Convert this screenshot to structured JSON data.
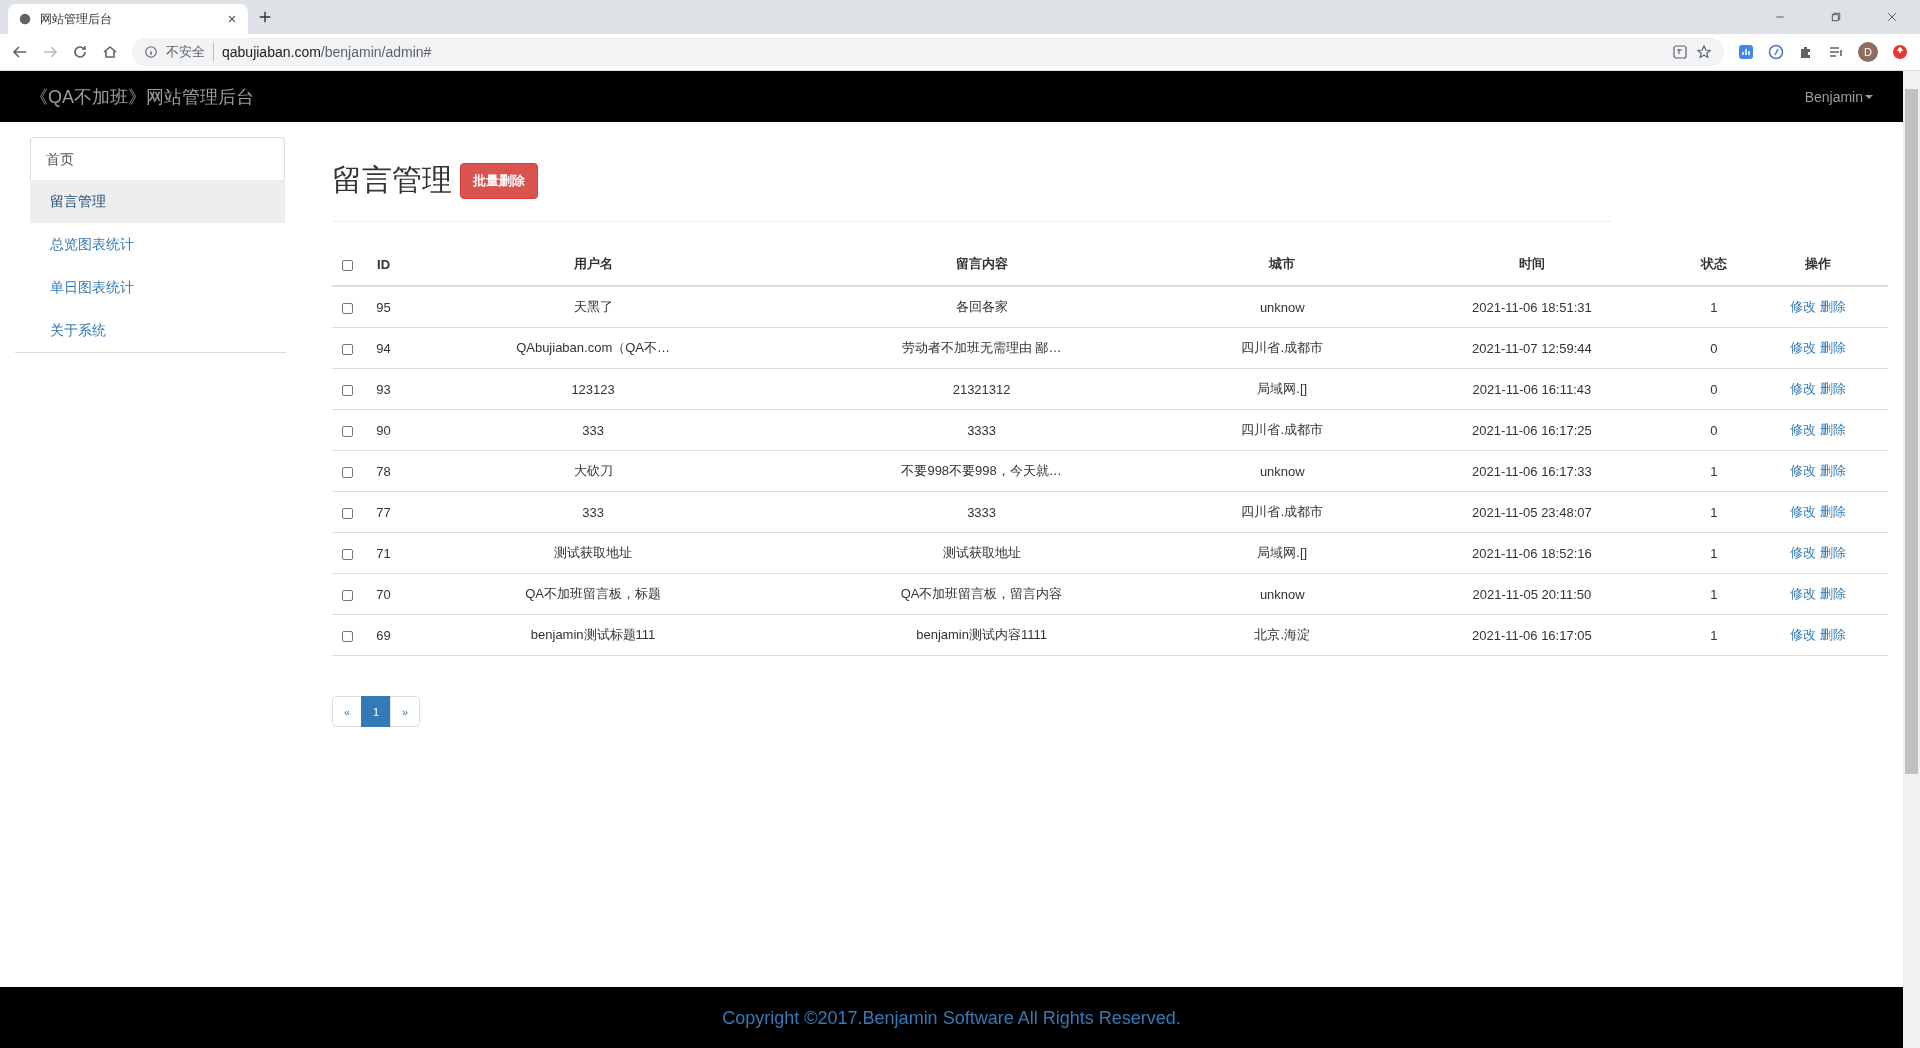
{
  "browser": {
    "tab_title": "网站管理后台",
    "security_label": "不安全",
    "url_host": "qabujiaban.com",
    "url_path": "/benjamin/admin#",
    "profile_initial": "D"
  },
  "navbar": {
    "brand": "《QA不加班》网站管理后台",
    "user": "Benjamin"
  },
  "sidebar": {
    "items": [
      {
        "label": "首页",
        "kind": "header",
        "selected": false
      },
      {
        "label": "留言管理",
        "kind": "link",
        "selected": true
      },
      {
        "label": "总览图表统计",
        "kind": "link",
        "selected": false
      },
      {
        "label": "单日图表统计",
        "kind": "link",
        "selected": false
      },
      {
        "label": "关于系统",
        "kind": "link",
        "selected": false
      }
    ]
  },
  "page": {
    "title": "留言管理",
    "bulk_delete": "批量删除"
  },
  "table": {
    "select_all_checked": false,
    "columns": [
      "ID",
      "用户名",
      "留言内容",
      "城市",
      "时间",
      "状态",
      "操作"
    ],
    "rows": [
      {
        "checked": false,
        "cells": [
          "95",
          "天黑了",
          "各回各家",
          "unknow",
          "2021-11-06 18:51:31",
          "1"
        ],
        "actions": [
          "修改",
          "删除"
        ]
      },
      {
        "checked": false,
        "cells": [
          "94",
          "QAbujiaban.com（QA不…",
          "劳动者不加班无需理由 鄙…",
          "四川省.成都市",
          "2021-11-07 12:59:44",
          "0"
        ],
        "actions": [
          "修改",
          "删除"
        ]
      },
      {
        "checked": false,
        "cells": [
          "93",
          "123123",
          "21321312",
          "局域网.[]",
          "2021-11-06 16:11:43",
          "0"
        ],
        "actions": [
          "修改",
          "删除"
        ]
      },
      {
        "checked": false,
        "cells": [
          "90",
          "333",
          "3333",
          "四川省.成都市",
          "2021-11-06 16:17:25",
          "0"
        ],
        "actions": [
          "修改",
          "删除"
        ]
      },
      {
        "checked": false,
        "cells": [
          "78",
          "大砍刀",
          "不要998不要998，今天就…",
          "unknow",
          "2021-11-06 16:17:33",
          "1"
        ],
        "actions": [
          "修改",
          "删除"
        ]
      },
      {
        "checked": false,
        "cells": [
          "77",
          "333",
          "3333",
          "四川省.成都市",
          "2021-11-05 23:48:07",
          "1"
        ],
        "actions": [
          "修改",
          "删除"
        ]
      },
      {
        "checked": false,
        "cells": [
          "71",
          "测试获取地址",
          "测试获取地址",
          "局域网.[]",
          "2021-11-06 18:52:16",
          "1"
        ],
        "actions": [
          "修改",
          "删除"
        ]
      },
      {
        "checked": false,
        "cells": [
          "70",
          "QA不加班留言板，标题",
          "QA不加班留言板，留言内容",
          "unknow",
          "2021-11-05 20:11:50",
          "1"
        ],
        "actions": [
          "修改",
          "删除"
        ]
      },
      {
        "checked": false,
        "cells": [
          "69",
          "benjamin测试标题111",
          "benjamin测试内容1111",
          "北京.海淀",
          "2021-11-06 16:17:05",
          "1"
        ],
        "actions": [
          "修改",
          "删除"
        ]
      }
    ]
  },
  "pagination": [
    {
      "label": "«",
      "selected": false
    },
    {
      "label": "1",
      "selected": true
    },
    {
      "label": "»",
      "selected": false
    }
  ],
  "footer": {
    "text": "Copyright ©2017.Benjamin Software All Rights Reserved."
  }
}
